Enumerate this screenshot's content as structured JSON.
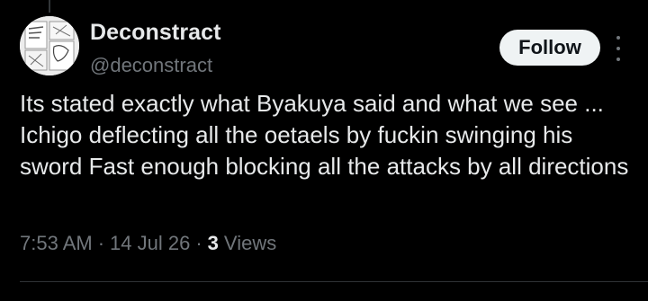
{
  "tweet": {
    "author": {
      "display_name": "Deconstract",
      "handle": "@deconstract",
      "avatar_icon": "manga-avatar"
    },
    "follow_label": "Follow",
    "more_icon": "more-vertical-icon",
    "text": "Its stated exactly what Byakuya said and what we see ... Ichigo deflecting all the oetaels by fuckin swinging his sword Fast enough blocking all the attacks by all directions",
    "meta": {
      "time": "7:53 AM",
      "separator": "·",
      "date": "14 Jul 26",
      "views_count": "3",
      "views_label": "Views"
    }
  },
  "colors": {
    "background": "#000000",
    "primary_text": "#e7e9ea",
    "secondary_text": "#71767b",
    "follow_bg": "#eff3f4",
    "follow_text": "#0f1419"
  }
}
